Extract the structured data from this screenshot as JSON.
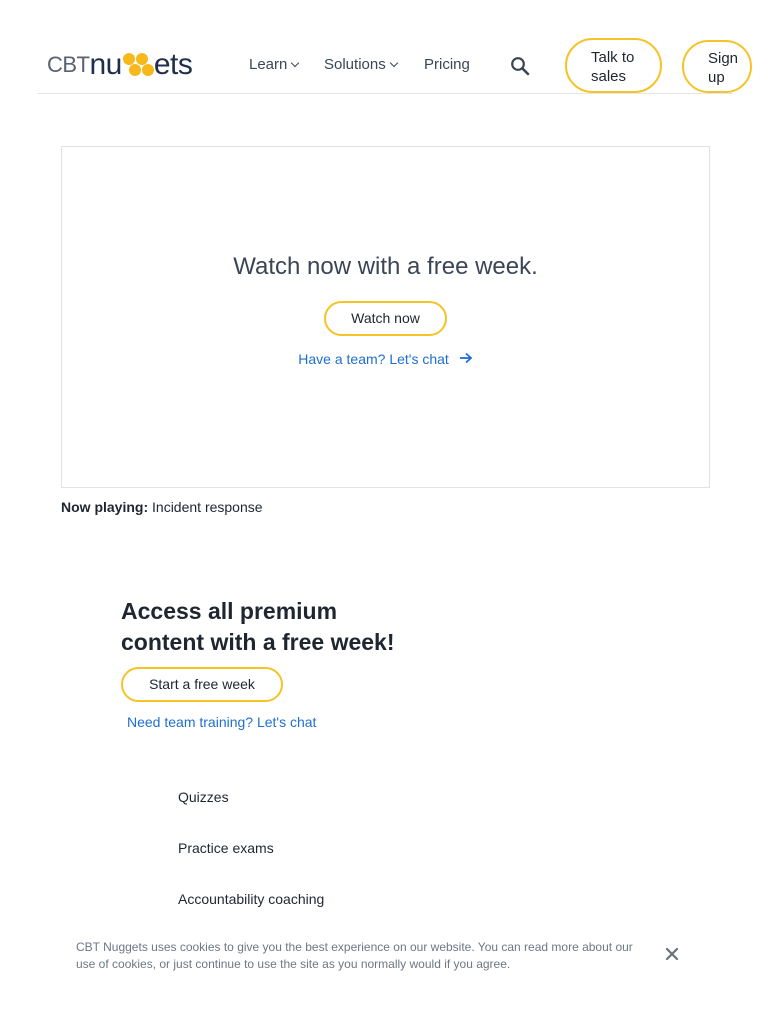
{
  "header": {
    "logo": {
      "cbt": "CBT",
      "nu": "nu",
      "ets": "ets",
      "brand": "CBT Nuggets"
    },
    "nav": [
      {
        "label": "Learn",
        "has_dropdown": true
      },
      {
        "label": "Solutions",
        "has_dropdown": true
      },
      {
        "label": "Pricing",
        "has_dropdown": false
      }
    ],
    "search_icon": "search-icon",
    "talk_to_sales": "Talk to sales",
    "sign_up": "Sign up"
  },
  "video": {
    "title": "Watch now with a free week.",
    "watch_button": "Watch now",
    "team_link": "Have a team? Let's chat",
    "team_link_icon": "arrow-right-icon"
  },
  "now_playing": {
    "label": "Now playing:",
    "value": "Incident response"
  },
  "promo": {
    "title": "Access all premium content with a free week!",
    "start_button": "Start a free week",
    "training_link": "Need team training? Let's chat"
  },
  "features": [
    "Quizzes",
    "Practice exams",
    "Accountability coaching"
  ],
  "cookie": {
    "text": "CBT Nuggets uses cookies to give you the best experience on our website. You can read more about our use of cookies, or just continue to use the site as you normally would if you agree.",
    "close_icon": "close-icon"
  },
  "colors": {
    "accent": "#f6c326",
    "link": "#1f6fd0",
    "brand_dark": "#1f2e4a",
    "logo_dots": "#f6b81a"
  }
}
